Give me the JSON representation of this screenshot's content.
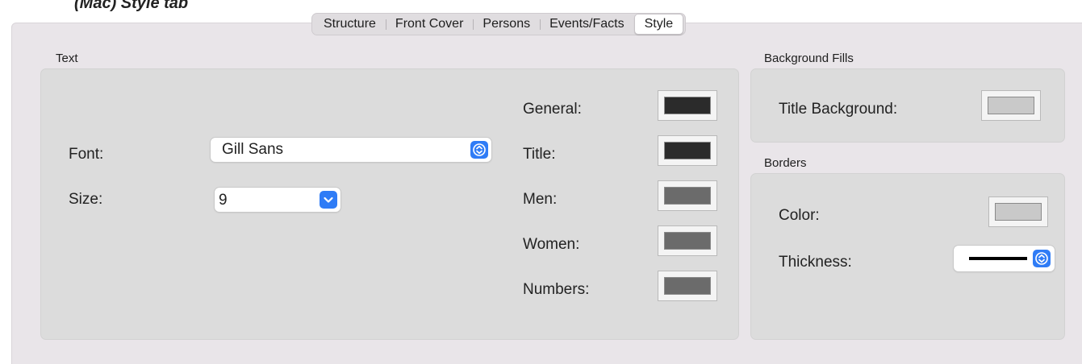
{
  "caption": "(Mac) Style tab",
  "tabs": [
    {
      "label": "Structure",
      "active": false
    },
    {
      "label": "Front Cover",
      "active": false
    },
    {
      "label": "Persons",
      "active": false
    },
    {
      "label": "Events/Facts",
      "active": false
    },
    {
      "label": "Style",
      "active": true
    }
  ],
  "text_section": {
    "title": "Text",
    "font_label": "Font:",
    "font_value": "Gill Sans",
    "size_label": "Size:",
    "size_value": "9",
    "colors": [
      {
        "label": "General:",
        "color": "#2b2b2b"
      },
      {
        "label": "Title:",
        "color": "#2b2b2b"
      },
      {
        "label": "Men:",
        "color": "#6b6b6b"
      },
      {
        "label": "Women:",
        "color": "#6b6b6b"
      },
      {
        "label": "Numbers:",
        "color": "#6b6b6b"
      }
    ]
  },
  "background_fills": {
    "title": "Background Fills",
    "title_background_label": "Title Background:",
    "title_background_color": "#c9c9c9"
  },
  "borders": {
    "title": "Borders",
    "color_label": "Color:",
    "color_value": "#c9c9c9",
    "thickness_label": "Thickness:"
  },
  "accent": "#2f7cf6"
}
